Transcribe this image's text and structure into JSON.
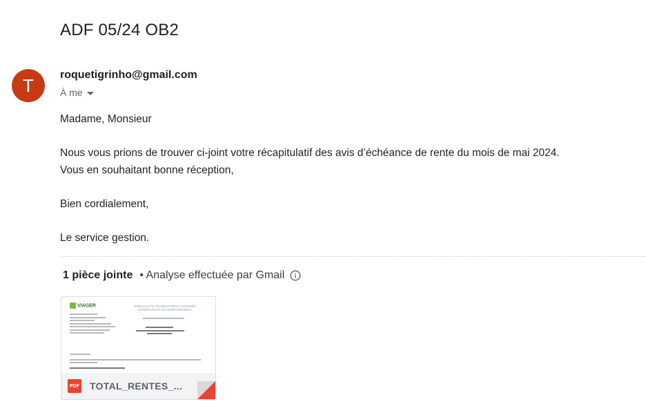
{
  "email": {
    "subject": "ADF 05/24 OB2",
    "sender_initial": "T",
    "sender_email": "roquetigrinho@gmail.com",
    "recipient": "À me",
    "body_lines": [
      "Madame, Monsieur",
      "Nous vous prions de trouver ci-joint votre récapitulatif des avis d’échéance de rente du mois de mai 2024.",
      "Vous en souhaitant bonne réception,",
      "Bien cordialement,",
      "Le service gestion."
    ]
  },
  "attachments": {
    "count_label": "1 pièce jointe",
    "scan_label": "• Analyse effectuée par Gmail",
    "file": {
      "type_badge": "PDF",
      "name": "TOTAL_RENTES_...",
      "preview_logo": "VIAGER",
      "preview_tagline": "SPÉCIALISTE TRANSACTIONS VIAGÈRES EXPERTISE ET ACCOMPAGNEMENT"
    }
  },
  "colors": {
    "avatar": "#c83a14",
    "pdf_badge": "#ea4335",
    "footer_bg": "#f1f3f4"
  },
  "icons": {
    "recipient_details": "caret-down-icon",
    "scan_info": "info-icon",
    "file_type": "pdf-icon"
  }
}
